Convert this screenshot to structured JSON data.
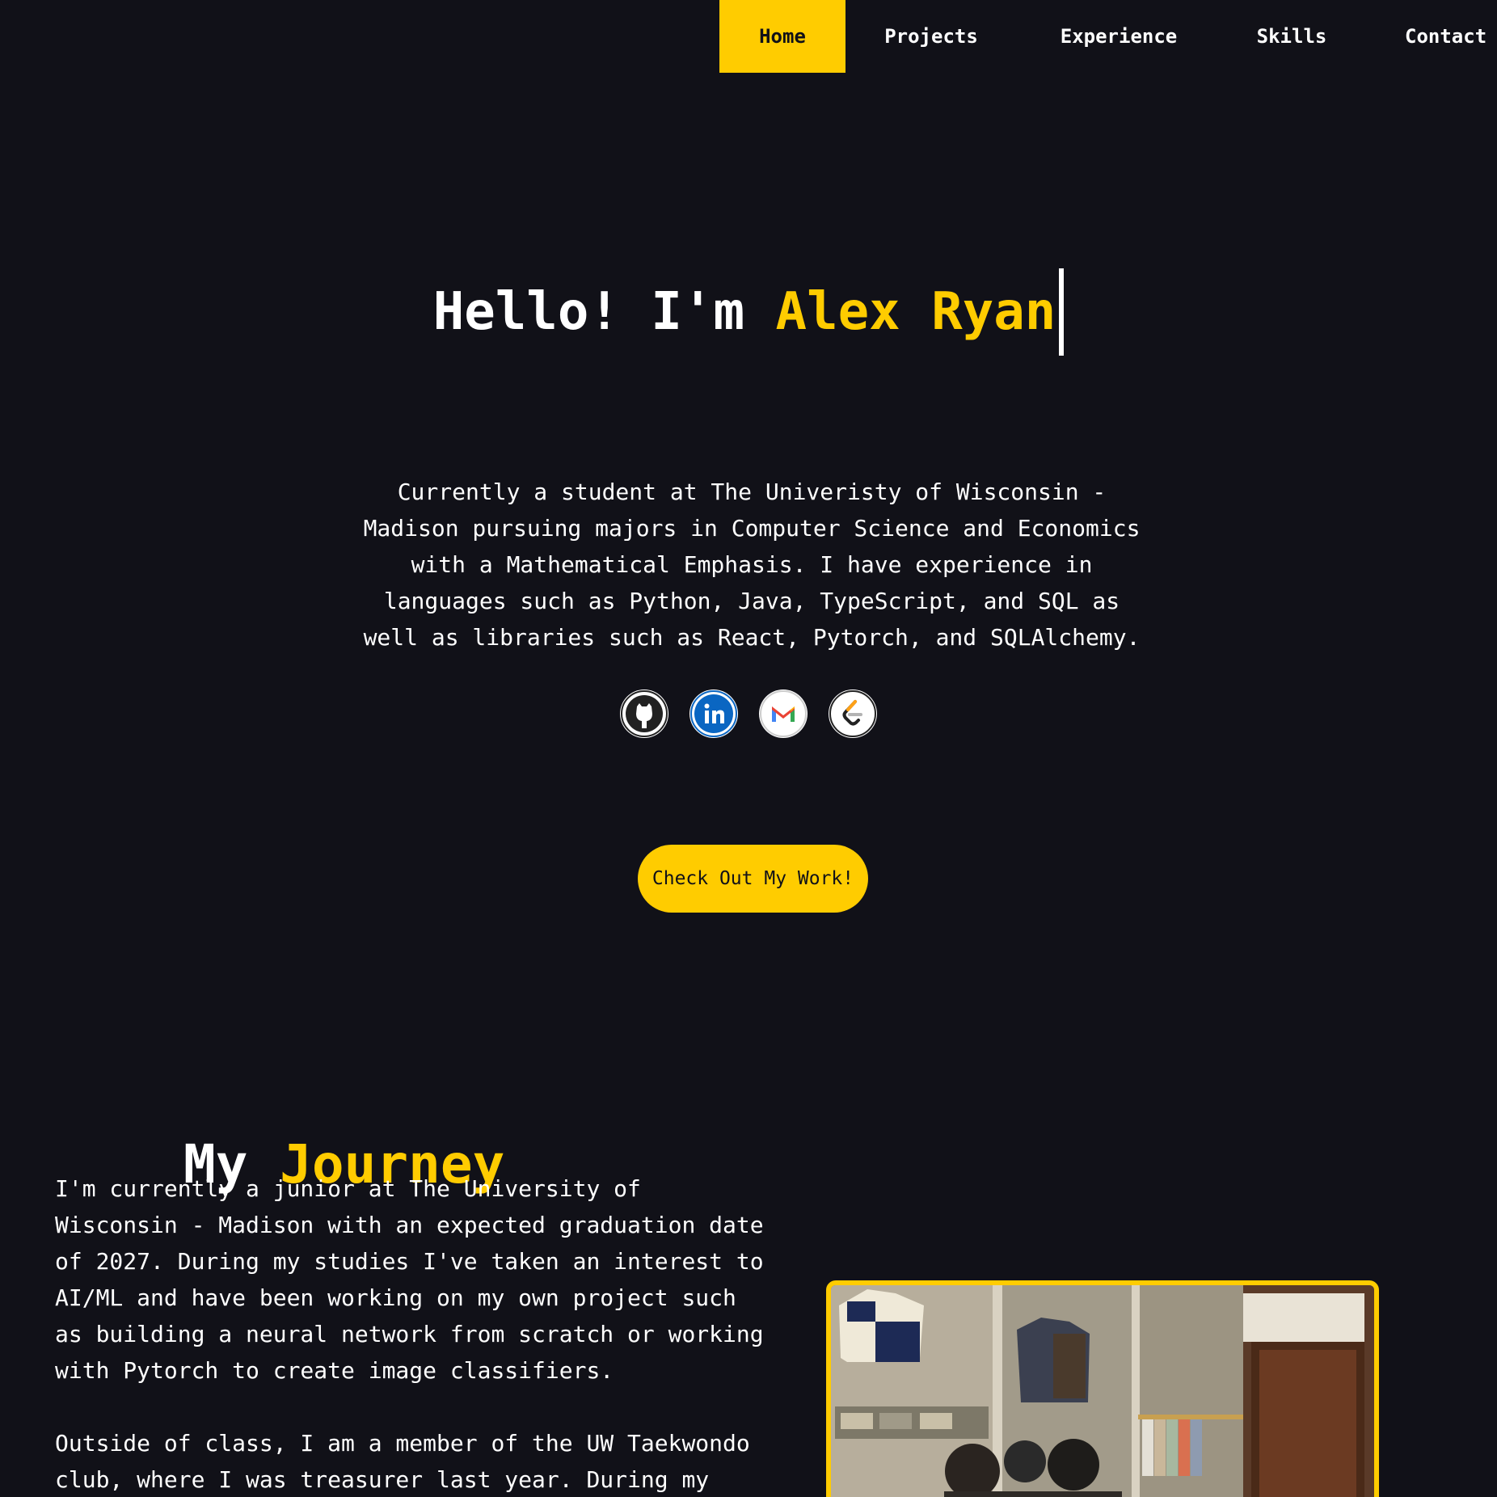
{
  "nav": {
    "items": [
      {
        "label": "Home",
        "active": true
      },
      {
        "label": "Projects",
        "active": false
      },
      {
        "label": "Experience",
        "active": false
      },
      {
        "label": "Skills",
        "active": false
      },
      {
        "label": "Contact",
        "active": false
      }
    ]
  },
  "hero": {
    "greeting": "Hello! I'm ",
    "name": "Alex Ryan",
    "description": "Currently a student at The Univeristy of Wisconsin - Madison pursuing majors in Computer Science and Economics with a Mathematical Emphasis. I have experience in languages such as Python, Java, TypeScript, and SQL as well as libraries such as React, Pytorch, and SQLAlchemy.",
    "socials": [
      {
        "icon": "github-icon"
      },
      {
        "icon": "linkedin-icon"
      },
      {
        "icon": "gmail-icon"
      },
      {
        "icon": "leetcode-icon"
      }
    ],
    "cta_label": "Check Out My Work!"
  },
  "journey": {
    "title_prefix": "My ",
    "title_accent": "Journey",
    "paragraphs": [
      "I'm currently a junior at The University of Wisconsin - Madison with an expected graduation date of 2027. During my studies I've taken an interest to AI/ML and have been working on my own project such as building a neural network from scratch or working with Pytorch to create image classifiers.",
      "Outside of class, I am a member of the UW Taekwondo club, where I was treasurer last year. During my"
    ]
  },
  "colors": {
    "background": "#111118",
    "accent": "#ffcc00",
    "text": "#ffffff"
  }
}
